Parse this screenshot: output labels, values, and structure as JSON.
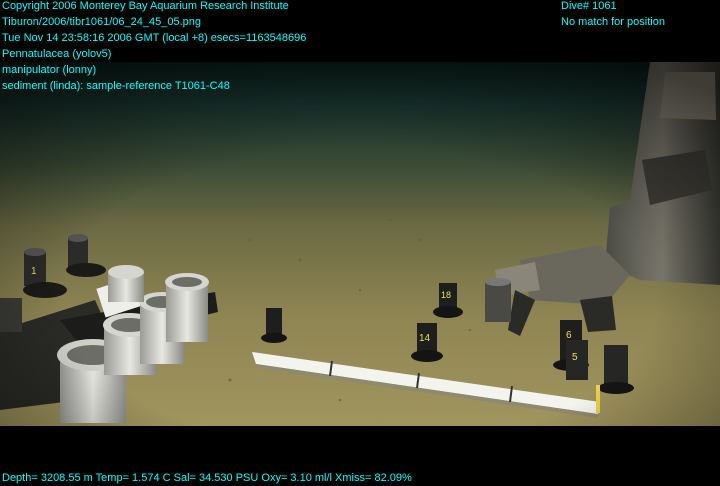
{
  "overlay": {
    "copyright": "Copyright 2006 Monterey Bay Aquarium Research Institute",
    "image_path": "Tiburon/2006/tibr1061/06_24_45_05.png",
    "datetime": "Tue Nov 14 23:58:16 2006 GMT (local +8)  esecs=1163548696",
    "annotation_1": "Pennatulacea (yolov5)",
    "annotation_2": "manipulator (lonny)",
    "annotation_3": "sediment (linda): sample-reference T1061-C48",
    "dive": "Dive# 1061",
    "position_status": "No match for position",
    "telemetry": "Depth= 3208.55 m  Temp= 1.574 C  Sal= 34.530 PSU  Oxy= 3.10 ml/l  Xmiss= 82.09%"
  },
  "scene": {
    "description_icon": "seafloor-scene",
    "core_labels": [
      "1",
      "18",
      "14",
      "6",
      "5"
    ]
  },
  "colors": {
    "overlay_text": "#00ffff",
    "sediment": "#8a8050",
    "water": "#1e3a30"
  }
}
